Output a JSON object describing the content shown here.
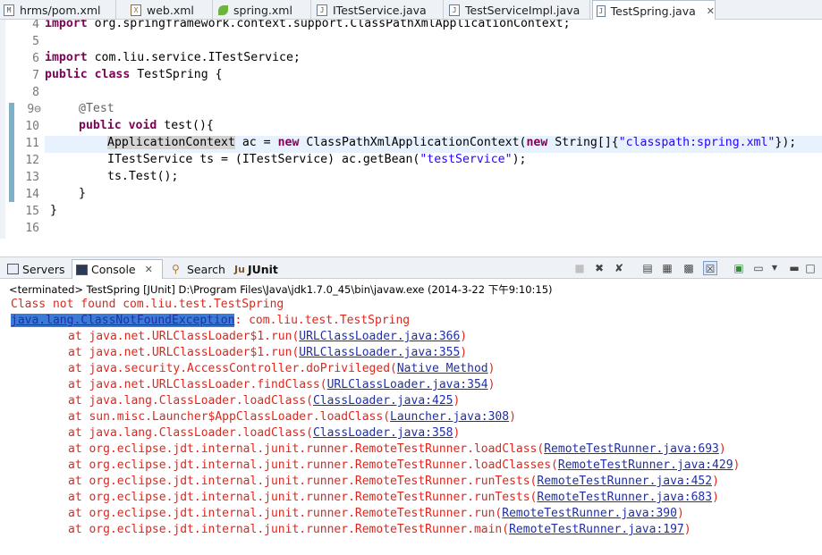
{
  "editor_tabs": [
    {
      "icon": "maven-pom-icon",
      "label": "hrms/pom.xml"
    },
    {
      "icon": "xml-file-icon",
      "label": "web.xml"
    },
    {
      "icon": "spring-file-icon",
      "label": "spring.xml"
    },
    {
      "icon": "java-interface-icon",
      "label": "ITestService.java"
    },
    {
      "icon": "java-file-icon",
      "label": "TestServiceImpl.java"
    },
    {
      "icon": "java-file-icon",
      "label": "TestSpring.java",
      "active": true,
      "close": "✕"
    }
  ],
  "editor": {
    "line_numbers": [
      "4",
      "5",
      "6",
      "7",
      "8",
      "9⊖",
      "10",
      "11",
      "12",
      "13",
      "14",
      "15",
      "16"
    ],
    "lines": {
      "l4_kw": "import",
      "l4_rest": " org.springframework.context.support.ClassPathXmlApplicationContext;",
      "l6_kw": "import",
      "l6_rest": " com.liu.service.ITestService;",
      "l7_kw1": "public",
      "l7_kw2": "class",
      "l7_rest": " TestSpring {",
      "l9_ann": "@Test",
      "l10_kw1": "public",
      "l10_kw2": "void",
      "l10_rest": " test(){",
      "l11_sel": "ApplicationContext",
      "l11_a": " ac = ",
      "l11_kw": "new",
      "l11_b": " ClassPathXmlApplicationContext(",
      "l11_kw2": "new",
      "l11_c": " String[]{",
      "l11_str": "\"classpath:spring.xml\"",
      "l11_d": "});",
      "l12_a": "ITestService ts = (ITestService) ac.getBean(",
      "l12_str": "\"testService\"",
      "l12_b": ");",
      "l13": "ts.Test();",
      "l14": "}",
      "l15": "}"
    },
    "scroll_left": "<"
  },
  "view_tabs": [
    {
      "icon": "servers-icon",
      "label": "Servers"
    },
    {
      "icon": "console-icon",
      "label": "Console",
      "active": true,
      "close": "✕"
    },
    {
      "icon": "search-icon",
      "label": "Search"
    },
    {
      "icon": "junit-icon",
      "label": "JUnit",
      "prefix": "Ju"
    }
  ],
  "toolbar_icons": [
    "terminate-icon",
    "remove-launch-icon",
    "remove-all-icon",
    "scroll-lock-icon",
    "pin-icon",
    "word-wrap-icon",
    "clear-console-icon",
    "display-selected-console-icon",
    "open-console-icon",
    "new-console-dropdown-icon",
    "minimize-icon",
    "maximize-icon"
  ],
  "console": {
    "status": "<terminated> TestSpring [JUnit] D:\\Program Files\\Java\\jdk1.7.0_45\\bin\\javaw.exe (2014-3-22 下午9:10:15)",
    "line1": "Class not found com.liu.test.TestSpring",
    "exception": "java.lang.ClassNotFoundException",
    "exception_rest": ": com.liu.test.TestSpring",
    "stack": [
      {
        "text": "at java.net.URLClassLoader$1.run(",
        "link": "URLClassLoader.java:366"
      },
      {
        "text": "at java.net.URLClassLoader$1.run(",
        "link": "URLClassLoader.java:355"
      },
      {
        "text": "at java.security.AccessController.doPrivileged(",
        "link": "Native Method"
      },
      {
        "text": "at java.net.URLClassLoader.findClass(",
        "link": "URLClassLoader.java:354"
      },
      {
        "text": "at java.lang.ClassLoader.loadClass(",
        "link": "ClassLoader.java:425"
      },
      {
        "text": "at sun.misc.Launcher$AppClassLoader.loadClass(",
        "link": "Launcher.java:308"
      },
      {
        "text": "at java.lang.ClassLoader.loadClass(",
        "link": "ClassLoader.java:358"
      },
      {
        "text": "at org.eclipse.jdt.internal.junit.runner.RemoteTestRunner.loadClass(",
        "link": "RemoteTestRunner.java:693"
      },
      {
        "text": "at org.eclipse.jdt.internal.junit.runner.RemoteTestRunner.loadClasses(",
        "link": "RemoteTestRunner.java:429"
      },
      {
        "text": "at org.eclipse.jdt.internal.junit.runner.RemoteTestRunner.runTests(",
        "link": "RemoteTestRunner.java:452"
      },
      {
        "text": "at org.eclipse.jdt.internal.junit.runner.RemoteTestRunner.runTests(",
        "link": "RemoteTestRunner.java:683"
      },
      {
        "text": "at org.eclipse.jdt.internal.junit.runner.RemoteTestRunner.run(",
        "link": "RemoteTestRunner.java:390"
      },
      {
        "text": "at org.eclipse.jdt.internal.junit.runner.RemoteTestRunner.main(",
        "link": "RemoteTestRunner.java:197"
      }
    ],
    "close_paren": ")"
  }
}
